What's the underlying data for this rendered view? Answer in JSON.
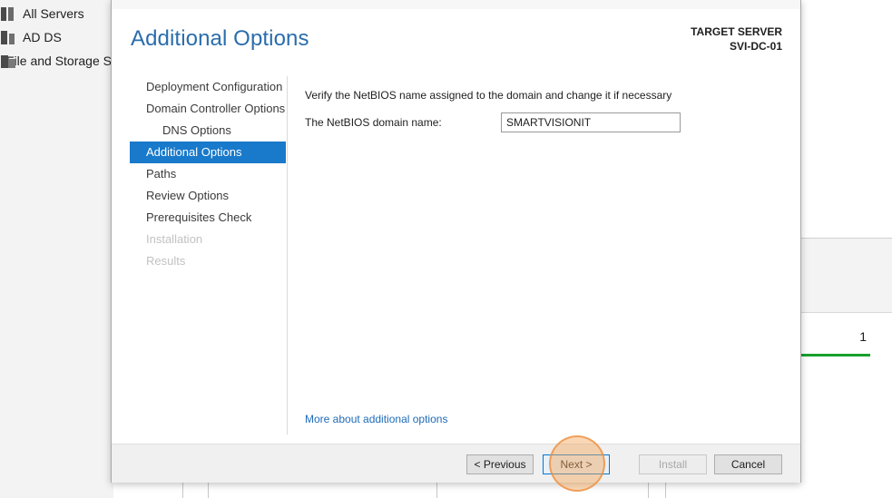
{
  "background": {
    "nav_items": [
      {
        "label": "All Servers",
        "icon": "servers-icon"
      },
      {
        "label": "AD DS",
        "icon": "ad-ds-icon"
      },
      {
        "label": "File and Storage Services",
        "icon": "file-storage-icon"
      }
    ],
    "tile_count": "1",
    "tile_bar_color": "#16a12c"
  },
  "dialog": {
    "title": "Additional Options",
    "target_server_label": "TARGET SERVER",
    "target_server_name": "SVI-DC-01",
    "accent_color": "#1979ca",
    "steps": [
      {
        "label": "Deployment Configuration",
        "state": "normal"
      },
      {
        "label": "Domain Controller Options",
        "state": "normal"
      },
      {
        "label": "DNS Options",
        "state": "normal"
      },
      {
        "label": "Additional Options",
        "state": "active"
      },
      {
        "label": "Paths",
        "state": "normal"
      },
      {
        "label": "Review Options",
        "state": "normal"
      },
      {
        "label": "Prerequisites Check",
        "state": "normal"
      },
      {
        "label": "Installation",
        "state": "disabled"
      },
      {
        "label": "Results",
        "state": "disabled"
      }
    ],
    "instruction": "Verify the NetBIOS name assigned to the domain and change it if necessary",
    "netbios_label": "The NetBIOS domain name:",
    "netbios_value": "SMARTVISIONIT",
    "more_link": "More about additional options",
    "buttons": {
      "previous": "< Previous",
      "next": "Next >",
      "install": "Install",
      "cancel": "Cancel"
    }
  }
}
